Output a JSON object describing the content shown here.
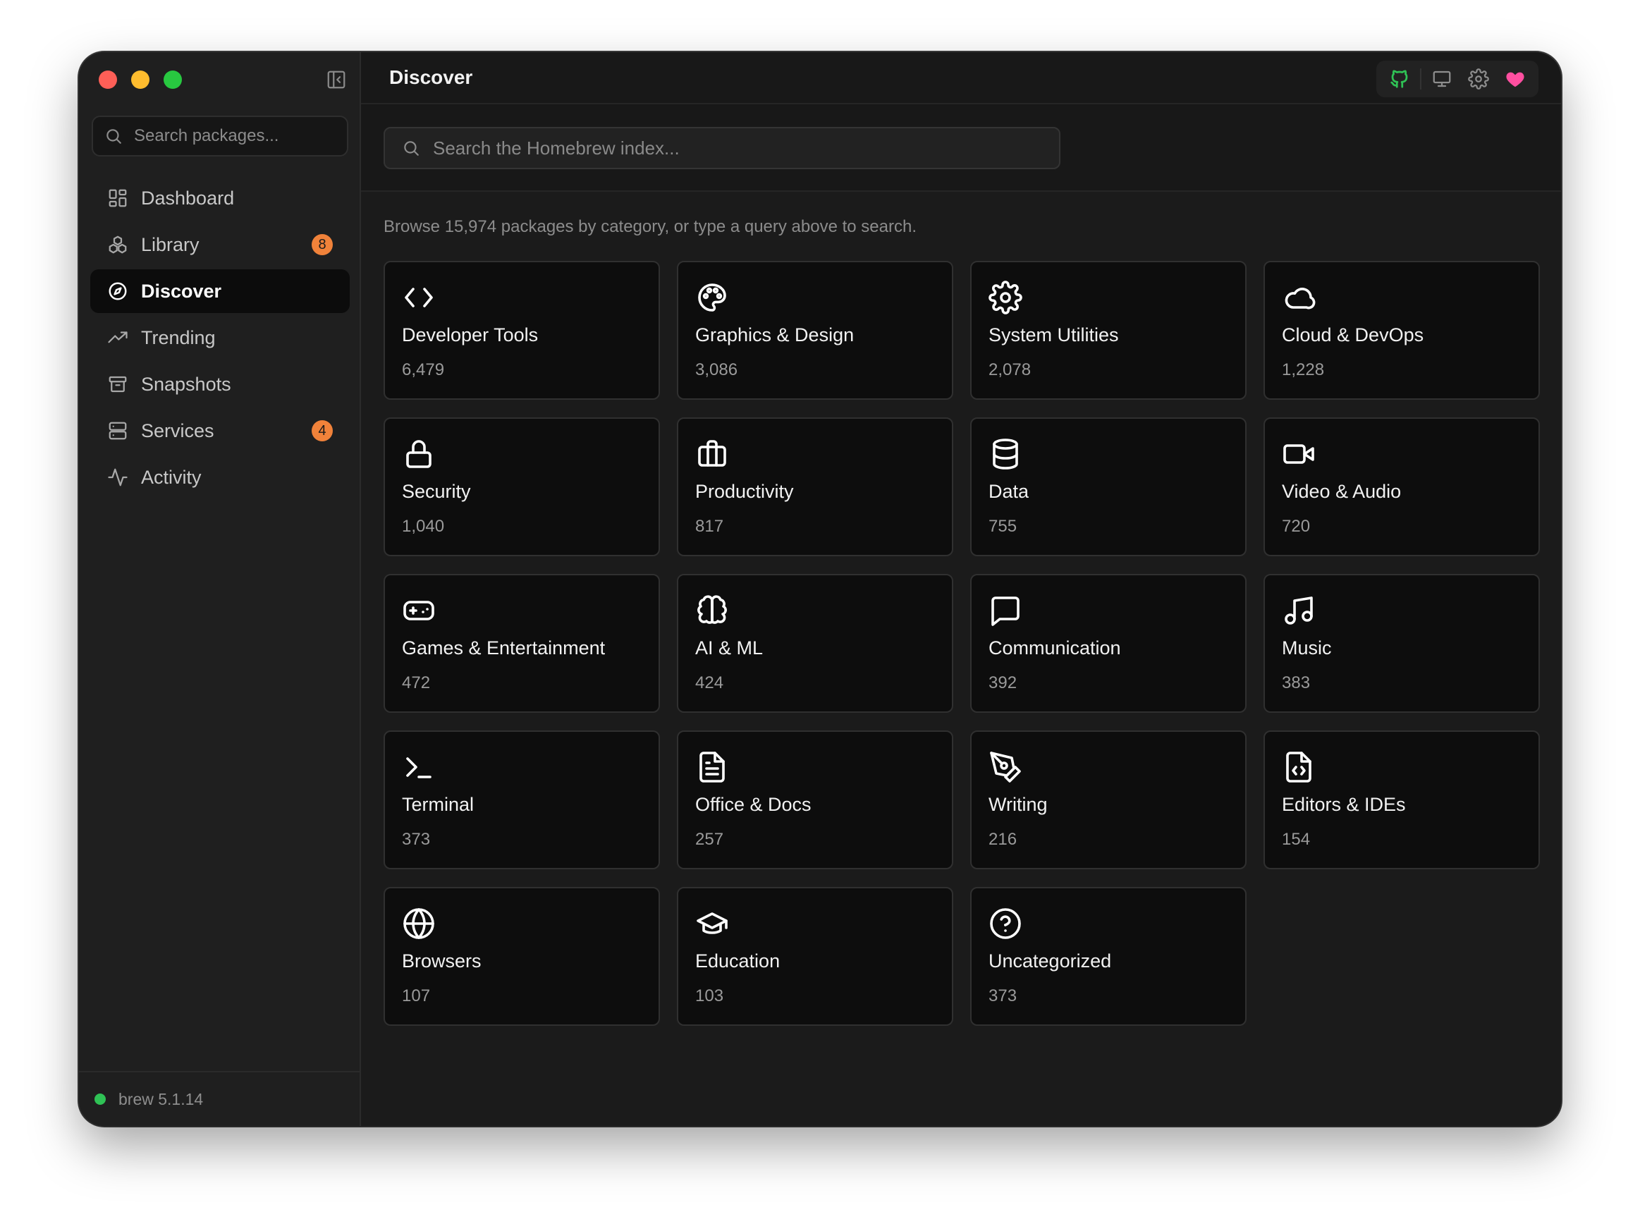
{
  "window": {
    "title": "Discover"
  },
  "sidebar": {
    "search_placeholder": "Search packages...",
    "items": [
      {
        "label": "Dashboard",
        "icon": "dashboard-icon",
        "badge": null,
        "active": false
      },
      {
        "label": "Library",
        "icon": "library-icon",
        "badge": "8",
        "active": false
      },
      {
        "label": "Discover",
        "icon": "compass-icon",
        "badge": null,
        "active": true
      },
      {
        "label": "Trending",
        "icon": "trending-icon",
        "badge": null,
        "active": false
      },
      {
        "label": "Snapshots",
        "icon": "archive-icon",
        "badge": null,
        "active": false
      },
      {
        "label": "Services",
        "icon": "server-icon",
        "badge": "4",
        "active": false
      },
      {
        "label": "Activity",
        "icon": "activity-icon",
        "badge": null,
        "active": false
      }
    ],
    "footer": {
      "version": "brew 5.1.14",
      "status_color": "#2fc255"
    }
  },
  "toolbar": {
    "icons": [
      "github-icon",
      "monitor-icon",
      "gear-icon",
      "heart-icon"
    ],
    "github_color": "#2fc255",
    "heart_color": "#ff4fa0"
  },
  "main": {
    "search_placeholder": "Search the Homebrew index...",
    "hint": "Browse 15,974 packages by category, or type a query above to search.",
    "categories": [
      {
        "name": "Developer Tools",
        "count": "6,479",
        "icon": "code-icon"
      },
      {
        "name": "Graphics & Design",
        "count": "3,086",
        "icon": "palette-icon"
      },
      {
        "name": "System Utilities",
        "count": "2,078",
        "icon": "gear-icon"
      },
      {
        "name": "Cloud & DevOps",
        "count": "1,228",
        "icon": "cloud-icon"
      },
      {
        "name": "Security",
        "count": "1,040",
        "icon": "lock-icon"
      },
      {
        "name": "Productivity",
        "count": "817",
        "icon": "briefcase-icon"
      },
      {
        "name": "Data",
        "count": "755",
        "icon": "database-icon"
      },
      {
        "name": "Video & Audio",
        "count": "720",
        "icon": "video-icon"
      },
      {
        "name": "Games & Entertainment",
        "count": "472",
        "icon": "gamepad-icon"
      },
      {
        "name": "AI & ML",
        "count": "424",
        "icon": "brain-icon"
      },
      {
        "name": "Communication",
        "count": "392",
        "icon": "chat-icon"
      },
      {
        "name": "Music",
        "count": "383",
        "icon": "music-icon"
      },
      {
        "name": "Terminal",
        "count": "373",
        "icon": "terminal-icon"
      },
      {
        "name": "Office & Docs",
        "count": "257",
        "icon": "document-icon"
      },
      {
        "name": "Writing",
        "count": "216",
        "icon": "pen-icon"
      },
      {
        "name": "Editors & IDEs",
        "count": "154",
        "icon": "code-file-icon"
      },
      {
        "name": "Browsers",
        "count": "107",
        "icon": "globe-icon"
      },
      {
        "name": "Education",
        "count": "103",
        "icon": "graduation-cap-icon"
      },
      {
        "name": "Uncategorized",
        "count": "373",
        "icon": "help-circle-icon"
      }
    ]
  }
}
